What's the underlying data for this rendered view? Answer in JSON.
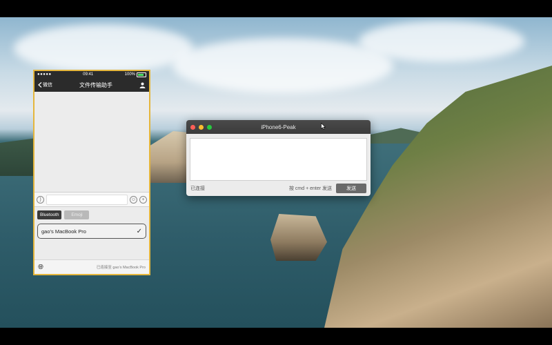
{
  "phone": {
    "status_bar": {
      "signal": "●●●●● ",
      "carrier": "",
      "time": "09:41",
      "battery": "100%"
    },
    "navbar": {
      "back_label": "微信",
      "title": "文件传输助手"
    },
    "tabs": [
      {
        "label": "Bluetooth",
        "active": true
      },
      {
        "label": "Emoji",
        "active": false
      }
    ],
    "devices": [
      {
        "name": "gao’s MacBook Pro",
        "selected": true
      }
    ],
    "footer": {
      "status": "已连接至 gao’s MacBook Pro"
    }
  },
  "mac_window": {
    "title": "iPhone6-Peak",
    "message_value": "",
    "status": "已连接",
    "hint": "按 cmd + enter 发送",
    "send_label": "发送"
  },
  "icons": [
    "back-chevron-icon",
    "person-icon",
    "voice-icon",
    "emoji-icon",
    "plus-icon",
    "checkmark-icon",
    "globe-icon",
    "cursor-icon"
  ],
  "colors": {
    "phone_border": "#e5b63c",
    "dark_bar": "#2b2b2b",
    "send_button": "#6a6a6a"
  }
}
